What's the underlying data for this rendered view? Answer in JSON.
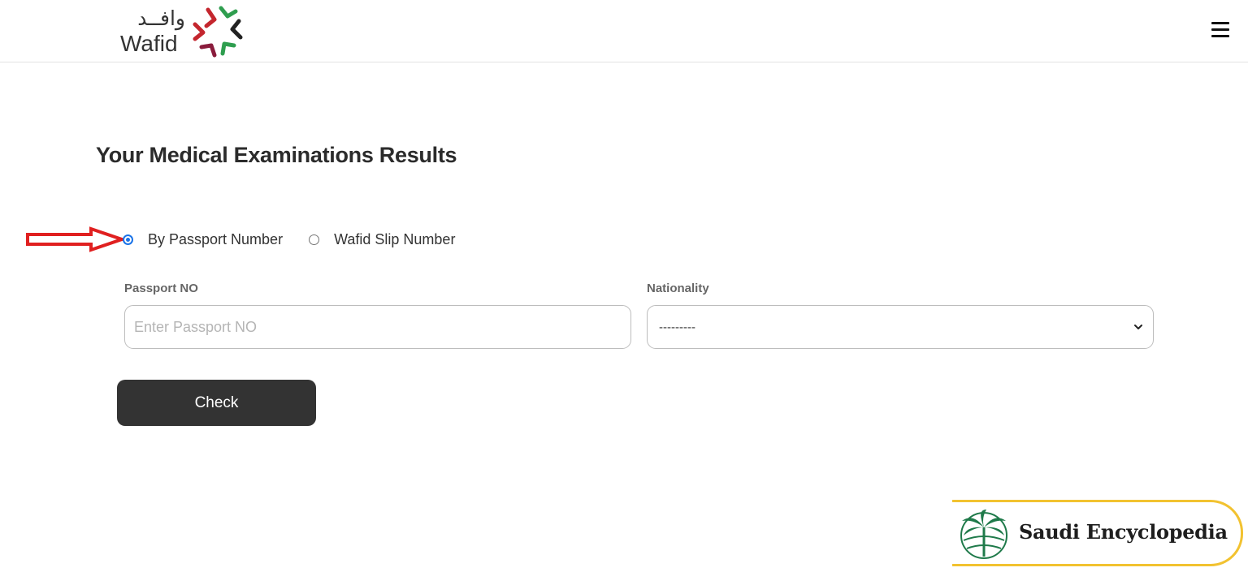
{
  "header": {
    "logo_arabic": "وافــد",
    "logo_english": "Wafid"
  },
  "page": {
    "title": "Your Medical Examinations Results"
  },
  "search_type": {
    "options": [
      {
        "label": "By Passport Number",
        "checked": true
      },
      {
        "label": "Wafid Slip Number",
        "checked": false
      }
    ]
  },
  "form": {
    "passport_label": "Passport NO",
    "passport_placeholder": "Enter Passport NO",
    "passport_value": "",
    "nationality_label": "Nationality",
    "nationality_selected": "---------",
    "check_label": "Check"
  },
  "watermark": {
    "text": "Saudi Encyclopedia"
  },
  "colors": {
    "button_bg": "#333333",
    "radio_accent": "#1a73e8",
    "arrow": "#e02020",
    "badge_border": "#f2c230",
    "badge_green": "#1f7a4a"
  },
  "icons": {
    "menu": "hamburger-icon",
    "select": "chevron-down-icon"
  }
}
